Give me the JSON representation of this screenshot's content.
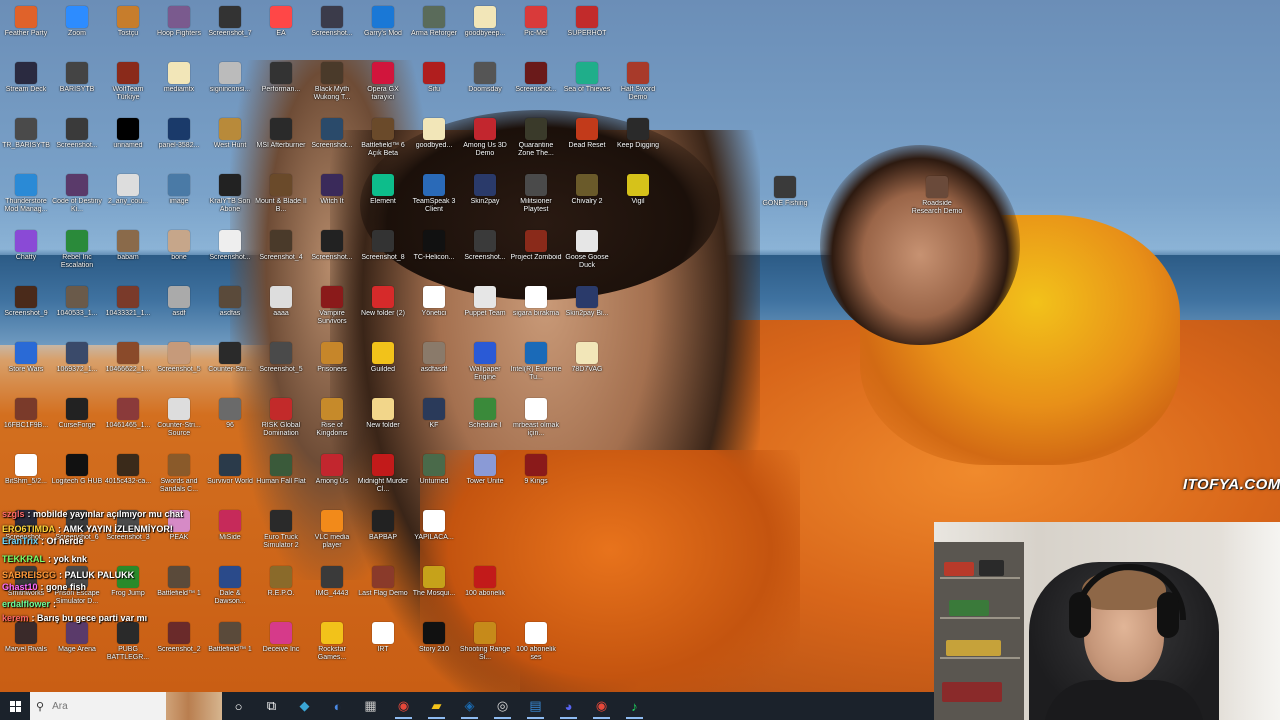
{
  "desktop": {
    "icons": [
      {
        "label": "Feather Party",
        "color": "#e0622a"
      },
      {
        "label": "Zoom",
        "color": "#2d8cff"
      },
      {
        "label": "Tostçu",
        "color": "#c77d2c"
      },
      {
        "label": "Hoop Fighters",
        "color": "#7a5a8e"
      },
      {
        "label": "Screenshot_7",
        "color": "#333333"
      },
      {
        "label": "EA",
        "color": "#ff4747"
      },
      {
        "label": "Screenshot...",
        "color": "#3b3b4a"
      },
      {
        "label": "Garry's Mod",
        "color": "#1a78d6"
      },
      {
        "label": "Arma Reforger",
        "color": "#5a6b5a"
      },
      {
        "label": "goodbyeep...",
        "color": "#f2e6b8"
      },
      {
        "label": "Pic-Me!",
        "color": "#d93a3a"
      },
      {
        "label": "SUPERHOT",
        "color": "#c22b2b"
      },
      {
        "label": "Stream Deck",
        "color": "#2a2a40"
      },
      {
        "label": "BARISYTB",
        "color": "#444444"
      },
      {
        "label": "WolfTeam Türkiye",
        "color": "#8a2a1a"
      },
      {
        "label": "mediamtx",
        "color": "#f2e6b8"
      },
      {
        "label": "signinconsi...",
        "color": "#bbbbbb"
      },
      {
        "label": "Performan...",
        "color": "#333333"
      },
      {
        "label": "Black Myth Wukong T...",
        "color": "#4a3a2a"
      },
      {
        "label": "Opera GX tarayıcı",
        "color": "#d1153c"
      },
      {
        "label": "Sifu",
        "color": "#b01e1e"
      },
      {
        "label": "Doomsday",
        "color": "#555555"
      },
      {
        "label": "Screenshot...",
        "color": "#6a1a1a"
      },
      {
        "label": "Sea of Thieves",
        "color": "#1fae8a"
      },
      {
        "label": "Half Sword Demo",
        "color": "#a83a2a"
      },
      {
        "label": "TR_BARISYTB",
        "color": "#4a4a4a"
      },
      {
        "label": "Screenshot...",
        "color": "#3a3a3a"
      },
      {
        "label": "unnamed",
        "color": "#000000"
      },
      {
        "label": "panel-3582...",
        "color": "#1a3a6a"
      },
      {
        "label": "West Hunt",
        "color": "#b88a3a"
      },
      {
        "label": "MSI Afterburner",
        "color": "#2a2a2a"
      },
      {
        "label": "Screenshot...",
        "color": "#2a4a6a"
      },
      {
        "label": "Battlefield™ 6 Açık Beta",
        "color": "#6a4a2a"
      },
      {
        "label": "goodbyed...",
        "color": "#f2e6b8"
      },
      {
        "label": "Among Us 3D Demo",
        "color": "#c2262e"
      },
      {
        "label": "Quarantine Zone The...",
        "color": "#3a3a2a"
      },
      {
        "label": "Dead Reset",
        "color": "#c23a1a"
      },
      {
        "label": "Keep Digging",
        "color": "#2a2a2a"
      },
      {
        "label": "Thunderstore Mod Manag...",
        "color": "#2a8ad6"
      },
      {
        "label": "Code of Destiny Ki...",
        "color": "#5a3a6a"
      },
      {
        "label": "2_any_cou...",
        "color": "#dddddd"
      },
      {
        "label": "image",
        "color": "#4a7aa6"
      },
      {
        "label": "KralYTB Son Abone",
        "color": "#222222"
      },
      {
        "label": "Mount & Blade II B...",
        "color": "#6a4a2a"
      },
      {
        "label": "Witch It",
        "color": "#3a2a5a"
      },
      {
        "label": "Element",
        "color": "#0dbd8b"
      },
      {
        "label": "TeamSpeak 3 Client",
        "color": "#2a6ab8"
      },
      {
        "label": "Skin2pay",
        "color": "#2a3a6a"
      },
      {
        "label": "Militsioner Playtest",
        "color": "#4a4a4a"
      },
      {
        "label": "Chivalry 2",
        "color": "#6a5a2a"
      },
      {
        "label": "Vigil",
        "color": "#d6c21a"
      },
      {
        "label": "Chatty",
        "color": "#8a4ad6"
      },
      {
        "label": "Rebel Inc Escalation",
        "color": "#2a8a3a"
      },
      {
        "label": "babam",
        "color": "#8a6a4a"
      },
      {
        "label": "bone",
        "color": "#c6a68a"
      },
      {
        "label": "Screenshot...",
        "color": "#eeeeee"
      },
      {
        "label": "Screenshot_4",
        "color": "#4a3a2a"
      },
      {
        "label": "Screenshot...",
        "color": "#222222"
      },
      {
        "label": "Screenshot_8",
        "color": "#333333"
      },
      {
        "label": "TC-Helicon...",
        "color": "#111111"
      },
      {
        "label": "Screenshot...",
        "color": "#3a3a3a"
      },
      {
        "label": "Project Zomboid",
        "color": "#8a2a1a"
      },
      {
        "label": "Goose Goose Duck",
        "color": "#e6e6e6"
      },
      {
        "label": "Screenshot_9",
        "color": "#4a2a1a"
      },
      {
        "label": "1040533_1...",
        "color": "#6a5a4a"
      },
      {
        "label": "10433321_1...",
        "color": "#7a3a2a"
      },
      {
        "label": "asdf",
        "color": "#aaaaaa"
      },
      {
        "label": "asdfas",
        "color": "#5a4a3a"
      },
      {
        "label": "aaaa",
        "color": "#dddddd"
      },
      {
        "label": "Vampire Survivors",
        "color": "#8a1a1a"
      },
      {
        "label": "New folder (2)",
        "color": "#d62a2a"
      },
      {
        "label": "Yönetici",
        "color": "#ffffff"
      },
      {
        "label": "Puppet Team",
        "color": "#e6e6e6"
      },
      {
        "label": "sigara bırakma",
        "color": "#ffffff"
      },
      {
        "label": "Skin2pay Bi...",
        "color": "#2a3a6a"
      },
      {
        "label": "Store Wars",
        "color": "#2a6ad6"
      },
      {
        "label": "1069372_1...",
        "color": "#3a4a6a"
      },
      {
        "label": "10466622_1...",
        "color": "#8a4a2a"
      },
      {
        "label": "Screenshot_5",
        "color": "#c69a7a"
      },
      {
        "label": "Counter-Stri...",
        "color": "#2a2a2a"
      },
      {
        "label": "Screenshot_5",
        "color": "#4a4a4a"
      },
      {
        "label": "Prisoners",
        "color": "#c6862a"
      },
      {
        "label": "Guilded",
        "color": "#f2c21a"
      },
      {
        "label": "asdfasdf",
        "color": "#8a7a6a"
      },
      {
        "label": "Wallpaper Engine",
        "color": "#2a5ad6"
      },
      {
        "label": "Intel(R) Extreme Tu...",
        "color": "#1a6ab8"
      },
      {
        "label": "78D7VAG",
        "color": "#f2e6b8"
      },
      {
        "label": "16FBC1F9B...",
        "color": "#7a3a2a"
      },
      {
        "label": "CurseForge",
        "color": "#222222"
      },
      {
        "label": "10461465_1...",
        "color": "#8a3a3a"
      },
      {
        "label": "Counter-Stri... Source",
        "color": "#dddddd"
      },
      {
        "label": "96",
        "color": "#6a6a6a"
      },
      {
        "label": "RISK Global Domination",
        "color": "#c22a2a"
      },
      {
        "label": "Rise of Kingdoms",
        "color": "#c68a2a"
      },
      {
        "label": "New folder",
        "color": "#f2d68a"
      },
      {
        "label": "KF",
        "color": "#2a3a5a"
      },
      {
        "label": "Schedule I",
        "color": "#3a8a3a"
      },
      {
        "label": "mrbeast olmak için...",
        "color": "#ffffff"
      },
      {
        "label": "BitShm_5/2...",
        "color": "#ffffff"
      },
      {
        "label": "Logitech G HUB",
        "color": "#111111"
      },
      {
        "label": "4015c432-ca...",
        "color": "#3a2a1a"
      },
      {
        "label": "Swords and Sandals C...",
        "color": "#8a5a2a"
      },
      {
        "label": "Survivor World",
        "color": "#2a3a4a"
      },
      {
        "label": "Human Fall Flat",
        "color": "#3a5a3a"
      },
      {
        "label": "Among Us",
        "color": "#c2262e"
      },
      {
        "label": "Midnight Murder Cl...",
        "color": "#c21a1a"
      },
      {
        "label": "Unturned",
        "color": "#4a6a4a"
      },
      {
        "label": "Tower Unite",
        "color": "#8a9ad6"
      },
      {
        "label": "9 Kings",
        "color": "#8a1a1a"
      },
      {
        "label": "Screenshot...",
        "color": "#2a2a3a"
      },
      {
        "label": "Screenshot_6",
        "color": "#3a3a3a"
      },
      {
        "label": "Screenshot_3",
        "color": "#4a4a4a"
      },
      {
        "label": "PEAK",
        "color": "#d68ac6"
      },
      {
        "label": "MiSide",
        "color": "#c62a5a"
      },
      {
        "label": "Euro Truck Simulator 2",
        "color": "#2a2a2a"
      },
      {
        "label": "VLC media player",
        "color": "#f28a1a"
      },
      {
        "label": "BAPBAP",
        "color": "#222222"
      },
      {
        "label": "YAPILACA...",
        "color": "#ffffff"
      },
      {
        "label": "Smithworks",
        "color": "#3a3a3a"
      },
      {
        "label": "Prison Escape Simulator D...",
        "color": "#4a4a4a"
      },
      {
        "label": "Frog Jump",
        "color": "#2a8a2a"
      },
      {
        "label": "Battlefield™ 1",
        "color": "#5a4a3a"
      },
      {
        "label": "Dale & Dawson...",
        "color": "#2a4a8a"
      },
      {
        "label": "R.E.P.O.",
        "color": "#8a6a2a"
      },
      {
        "label": "IMG_4443",
        "color": "#3a3a3a"
      },
      {
        "label": "Last Flag Demo",
        "color": "#8a3a2a"
      },
      {
        "label": "The Mosqui...",
        "color": "#c6a21a"
      },
      {
        "label": "100 abonelik",
        "color": "#c21a1a"
      },
      {
        "label": "Marvel Rivals",
        "color": "#3a2a2a"
      },
      {
        "label": "Mage Arena",
        "color": "#5a3a6a"
      },
      {
        "label": "PUBG BATTLEGR...",
        "color": "#2a2a2a"
      },
      {
        "label": "Screenshot_2",
        "color": "#6a2a2a"
      },
      {
        "label": "Battlefield™ 1",
        "color": "#5a4a3a"
      },
      {
        "label": "Deceive Inc",
        "color": "#d63a8a"
      },
      {
        "label": "Rockstar Games...",
        "color": "#f2c21a"
      },
      {
        "label": "IRT",
        "color": "#ffffff"
      },
      {
        "label": "Story 210",
        "color": "#111111"
      },
      {
        "label": "Shooting Range Si...",
        "color": "#c68a1a"
      },
      {
        "label": "100 abonelik ses",
        "color": "#ffffff"
      },
      {
        "label": "Roadside Research Demo",
        "color": "#6a4a3a"
      },
      {
        "label": "GONE Fishing",
        "color": "#3a3a3a"
      }
    ]
  },
  "chat": {
    "messages": [
      {
        "user": "szgls",
        "text": ": mobilde yayınlar açılmıyor mu chat",
        "color": "#ff6a6a"
      },
      {
        "user": "ERO6TIMDA",
        "text": ": AMK YAYIN İZLENMİYOR!",
        "color": "#ffd43a"
      },
      {
        "user": "EranTrix",
        "text": ": Of nerde",
        "color": "#6ad6ff"
      },
      {
        "user": "TEKKRAL",
        "text": ": yok knk",
        "color": "#7aff6a"
      },
      {
        "user": "SABREISGG",
        "text": ": PALUK PALUKK",
        "color": "#ff9a3a"
      },
      {
        "user": "Ghast10",
        "text": ": gone fish",
        "color": "#ff6aff"
      },
      {
        "user": "erdalflower",
        "text": ":",
        "color": "#6aff9a"
      },
      {
        "user": "kerem",
        "text": ": Barış bu gece parti var mı",
        "color": "#ff6a6a"
      }
    ]
  },
  "wallpaper": {
    "watermark": "ITOFYA.COM"
  },
  "taskbar": {
    "search_placeholder": "Ara",
    "apps": [
      {
        "icon": "cortana-icon",
        "glyph": "○",
        "color": "#ffffff"
      },
      {
        "icon": "task-view-icon",
        "glyph": "⧉",
        "color": "#ffffff"
      },
      {
        "icon": "streamdeck-taskbar-icon",
        "glyph": "◆",
        "color": "#3aa6d6"
      },
      {
        "icon": "copilot-icon",
        "glyph": "◐",
        "color": "#4a8ae6"
      },
      {
        "icon": "calculator-icon",
        "glyph": "▦",
        "color": "#c6c6c6"
      },
      {
        "icon": "chrome-icon",
        "glyph": "◉",
        "color": "#e6483a"
      },
      {
        "icon": "file-explorer-icon",
        "glyph": "▰",
        "color": "#f2c21a"
      },
      {
        "icon": "steam-icon",
        "glyph": "◈",
        "color": "#1b6ab0"
      },
      {
        "icon": "obs-icon",
        "glyph": "◎",
        "color": "#dddddd"
      },
      {
        "icon": "app-icon",
        "glyph": "▤",
        "color": "#3a8ad6"
      },
      {
        "icon": "discord-icon",
        "glyph": "◕",
        "color": "#5865f2"
      },
      {
        "icon": "chrome-profile-icon",
        "glyph": "◉",
        "color": "#e6483a"
      },
      {
        "icon": "spotify-icon",
        "glyph": "♪",
        "color": "#1ed760"
      }
    ]
  }
}
